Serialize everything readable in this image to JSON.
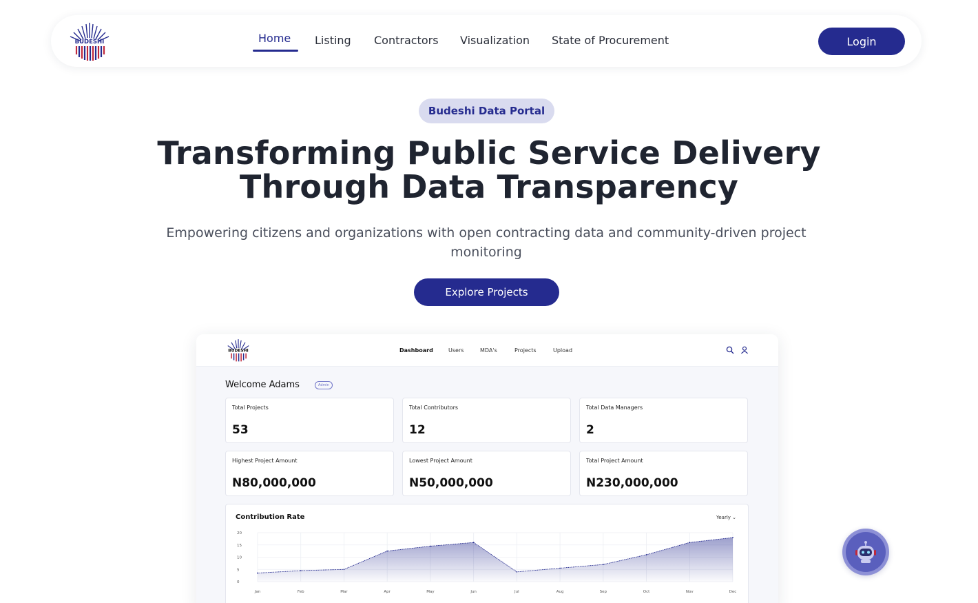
{
  "nav": {
    "logo_icon": "budeshi-logo",
    "logo_text": "BUDESHI",
    "links": [
      "Home",
      "Listing",
      "Contractors",
      "Visualization",
      "State of Procurement"
    ],
    "active": "Home",
    "login_label": "Login"
  },
  "hero": {
    "badge": "Budeshi Data Portal",
    "title_line1": "Transforming Public Service Delivery",
    "title_line2": "Through Data Transparency",
    "subtitle": "Empowering citizens and organizations with open contracting data and community-driven project monitoring",
    "cta_label": "Explore Projects"
  },
  "preview": {
    "logo_text": "BUDESHI",
    "nav": [
      "Dashboard",
      "Users",
      "MDA's",
      "Projects",
      "Upload"
    ],
    "active_nav": "Dashboard",
    "icons": [
      "search-icon",
      "user-icon"
    ],
    "welcome": "Welcome Adams",
    "role_tag": "Admin",
    "stats": [
      {
        "label": "Total Projects",
        "value": "53"
      },
      {
        "label": "Total Contributors",
        "value": "12"
      },
      {
        "label": "Total Data Managers",
        "value": "2"
      },
      {
        "label": "Highest Project Amount",
        "value": "N80,000,000"
      },
      {
        "label": "Lowest Project Amount",
        "value": "N50,000,000"
      },
      {
        "label": "Total Project Amount",
        "value": "N230,000,000"
      }
    ],
    "chart_title": "Contribution Rate",
    "chart_filter": "Yearly"
  },
  "chart_data": {
    "type": "area",
    "title": "Contribution Rate",
    "xlabel": "",
    "ylabel": "",
    "categories": [
      "Jan",
      "Feb",
      "Mar",
      "Apr",
      "May",
      "Jun",
      "Jul",
      "Aug",
      "Sep",
      "Oct",
      "Nov",
      "Dec"
    ],
    "values": [
      3.5,
      4.5,
      5,
      12.5,
      14.5,
      16,
      4,
      5.5,
      7,
      11,
      16,
      18
    ],
    "yticks": [
      0,
      5,
      10,
      15,
      20
    ],
    "ylim": [
      0,
      20
    ],
    "grid": true,
    "color": "#252b8f"
  },
  "chatbot": {
    "icon": "robot-icon"
  },
  "colors": {
    "brand": "#252b8f",
    "badge_bg": "#d9dbef"
  }
}
